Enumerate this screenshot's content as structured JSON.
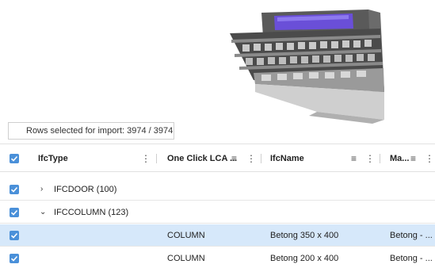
{
  "import_status": {
    "rows_selected": "Rows selected for import: 3974 / 3974"
  },
  "grid": {
    "columns": [
      {
        "label": "IfcType"
      },
      {
        "label": "One Click LCA ..."
      },
      {
        "label": "IfcName"
      },
      {
        "label": "Ma..."
      }
    ],
    "groups": [
      {
        "label": "IFCDOOR (100)",
        "expanded": false
      },
      {
        "label": "IFCCOLUMN (123)",
        "expanded": true
      }
    ],
    "rows": [
      {
        "lca": "COLUMN",
        "name": "Betong 350 x 400",
        "material": "Betong - ...",
        "selected": true
      },
      {
        "lca": "COLUMN",
        "name": "Betong 200 x 400",
        "material": "Betong - ...",
        "selected": false
      }
    ]
  },
  "colors": {
    "accent": "#4a90d9",
    "selected_row": "#d6e8fa"
  }
}
